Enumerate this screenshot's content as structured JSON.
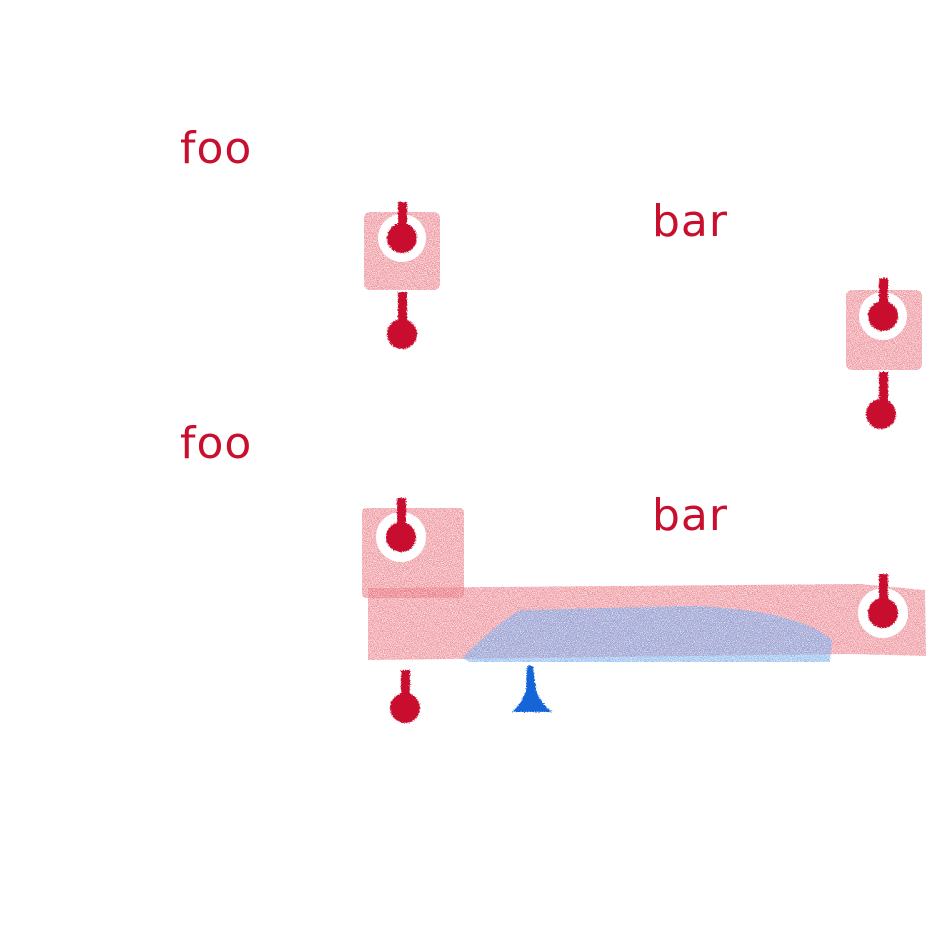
{
  "colors": {
    "background": "#ffffff",
    "red": "#c8102e",
    "red_shade": "#e8707c",
    "red_shade_light": "#f3b3b9",
    "blue": "#1565d8",
    "blue_shade": "#6fa6ec"
  },
  "example_1": {
    "label_left": "foo",
    "label_right": "bar"
  },
  "example_2": {
    "label_left": "foo",
    "label_right": "bar"
  },
  "icons": [
    "red-pin-icon",
    "blue-marker-icon"
  ]
}
